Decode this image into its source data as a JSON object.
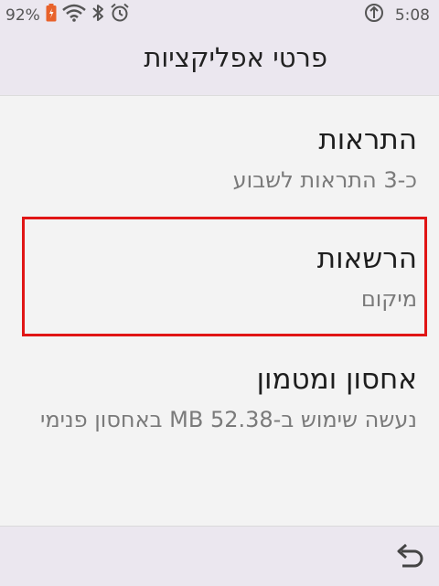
{
  "status_bar": {
    "battery_percent": "92%",
    "time": "5:08"
  },
  "app_bar": {
    "title": "פרטי אפליקציות"
  },
  "settings": [
    {
      "title": "התראות",
      "subtitle": "כ-3 התראות לשבוע"
    },
    {
      "title": "הרשאות",
      "subtitle": "מיקום"
    },
    {
      "title": "אחסון ומטמון",
      "subtitle": "נעשה שימוש ב-52.38 MB באחסון פנימי"
    }
  ],
  "colors": {
    "bars": "#ebe7ef",
    "background": "#f3f3f3",
    "highlight_border": "#e01515",
    "battery": "#e8622b"
  },
  "icons": [
    "battery-icon",
    "wifi-icon",
    "bluetooth-icon",
    "alarm-icon",
    "data-saver-icon",
    "back-icon"
  ]
}
